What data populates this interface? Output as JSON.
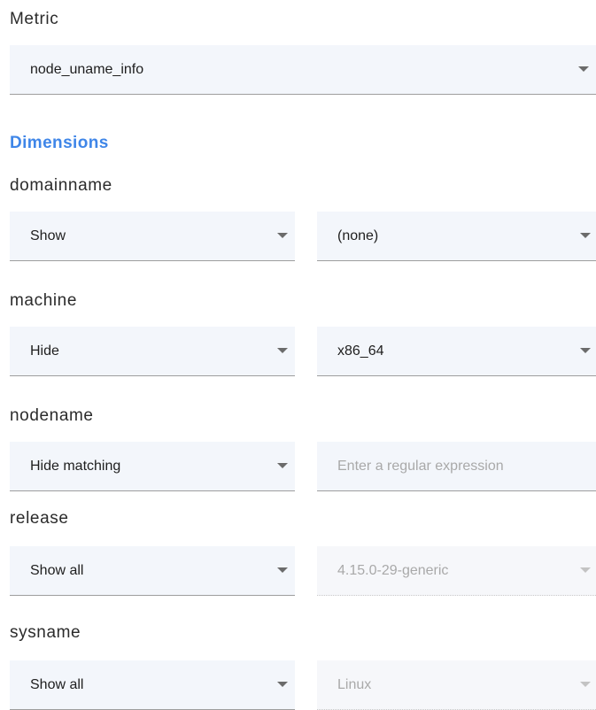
{
  "metric": {
    "label": "Metric",
    "value": "node_uname_info"
  },
  "dimensions_title": "Dimensions",
  "dimensions": [
    {
      "name": "domainname",
      "mode": "Show",
      "value": "(none)"
    },
    {
      "name": "machine",
      "mode": "Hide",
      "value": "x86_64"
    },
    {
      "name": "nodename",
      "mode": "Hide matching",
      "value": "",
      "placeholder": "Enter a regular expression"
    },
    {
      "name": "release",
      "mode": "Show all",
      "value": "4.15.0-29-generic"
    },
    {
      "name": "sysname",
      "mode": "Show all",
      "value": "Linux"
    }
  ],
  "colors": {
    "accent": "#3f86e8",
    "field_background": "#f3f6fb",
    "disabled_text": "#a9a9a9"
  },
  "icons": {
    "dropdown": "chevron-down-icon"
  }
}
